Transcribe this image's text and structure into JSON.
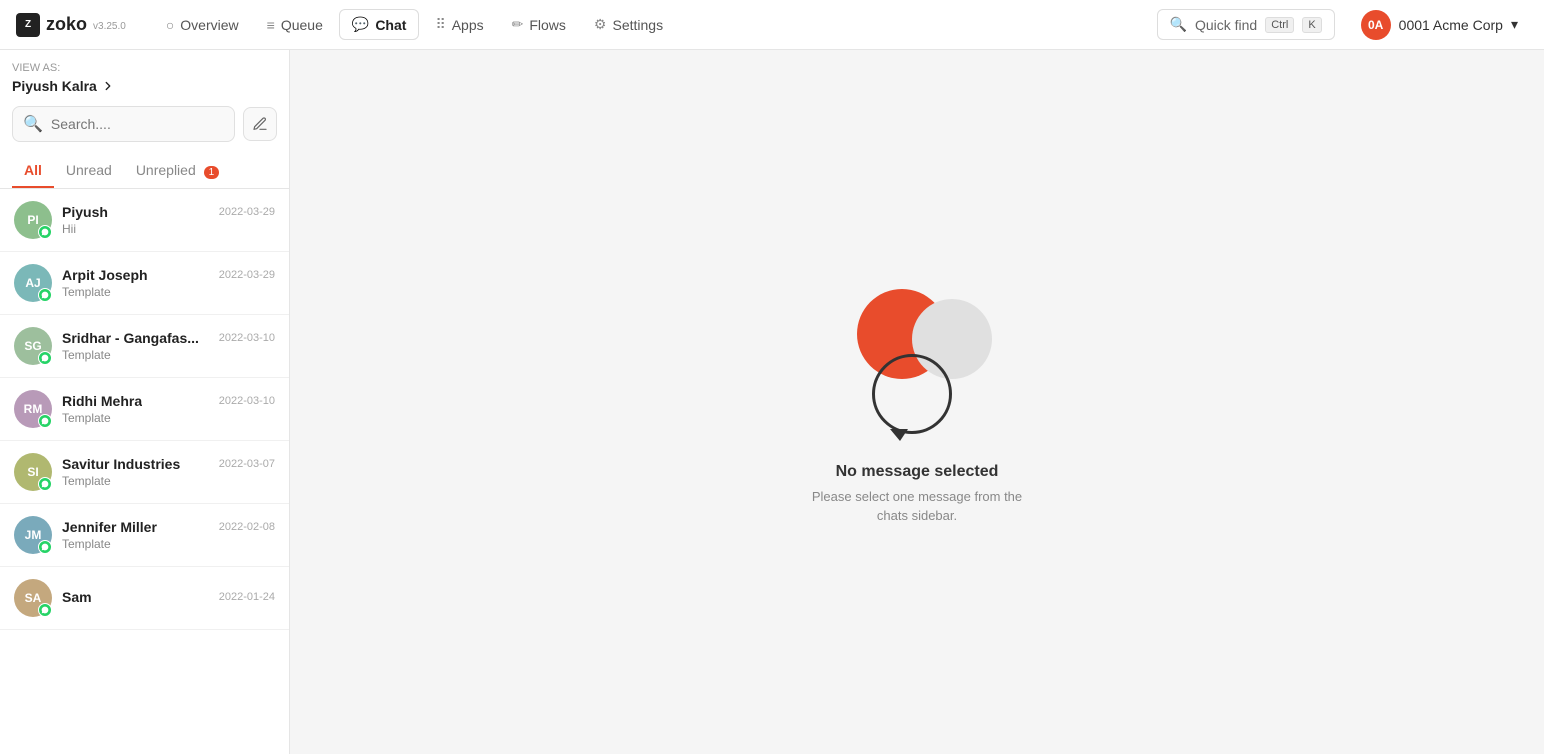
{
  "app": {
    "logo_text": "zoko",
    "logo_version": "v3.25.0"
  },
  "nav": {
    "overview_label": "Overview",
    "queue_label": "Queue",
    "chat_label": "Chat",
    "apps_label": "Apps",
    "flows_label": "Flows",
    "settings_label": "Settings",
    "active": "Chat"
  },
  "quick_find": {
    "label": "Quick find",
    "kbd1": "Ctrl",
    "kbd2": "K"
  },
  "account": {
    "name": "0001 Acme Corp",
    "initials": "0A"
  },
  "sidebar": {
    "view_as_label": "VIEW AS:",
    "view_as_name": "Piyush Kalra",
    "search_placeholder": "Search....",
    "tabs": [
      {
        "id": "all",
        "label": "All",
        "active": true,
        "badge": null
      },
      {
        "id": "unread",
        "label": "Unread",
        "active": false,
        "badge": null
      },
      {
        "id": "unreplied",
        "label": "Unreplied",
        "active": false,
        "badge": "1"
      }
    ],
    "chats": [
      {
        "id": "1",
        "name": "Piyush",
        "initials": "PI",
        "avatar_class": "avatar-green",
        "preview": "Hii",
        "date": "2022-03-29"
      },
      {
        "id": "2",
        "name": "Arpit Joseph",
        "initials": "AJ",
        "avatar_class": "avatar-teal",
        "preview": "Template",
        "date": "2022-03-29"
      },
      {
        "id": "3",
        "name": "Sridhar - Gangafas...",
        "initials": "SG",
        "avatar_class": "avatar-sage",
        "preview": "Template",
        "date": "2022-03-10"
      },
      {
        "id": "4",
        "name": "Ridhi Mehra",
        "initials": "RM",
        "avatar_class": "avatar-mauve",
        "preview": "Template",
        "date": "2022-03-10"
      },
      {
        "id": "5",
        "name": "Savitur Industries",
        "initials": "SI",
        "avatar_class": "avatar-olive",
        "preview": "Template",
        "date": "2022-03-07"
      },
      {
        "id": "6",
        "name": "Jennifer Miller",
        "initials": "JM",
        "avatar_class": "avatar-blue",
        "preview": "Template",
        "date": "2022-02-08"
      },
      {
        "id": "7",
        "name": "Sam",
        "initials": "SA",
        "avatar_class": "avatar-sand",
        "preview": "",
        "date": "2022-01-24"
      }
    ]
  },
  "empty_state": {
    "title": "No message selected",
    "subtitle": "Please select one message from the\nchats sidebar."
  }
}
